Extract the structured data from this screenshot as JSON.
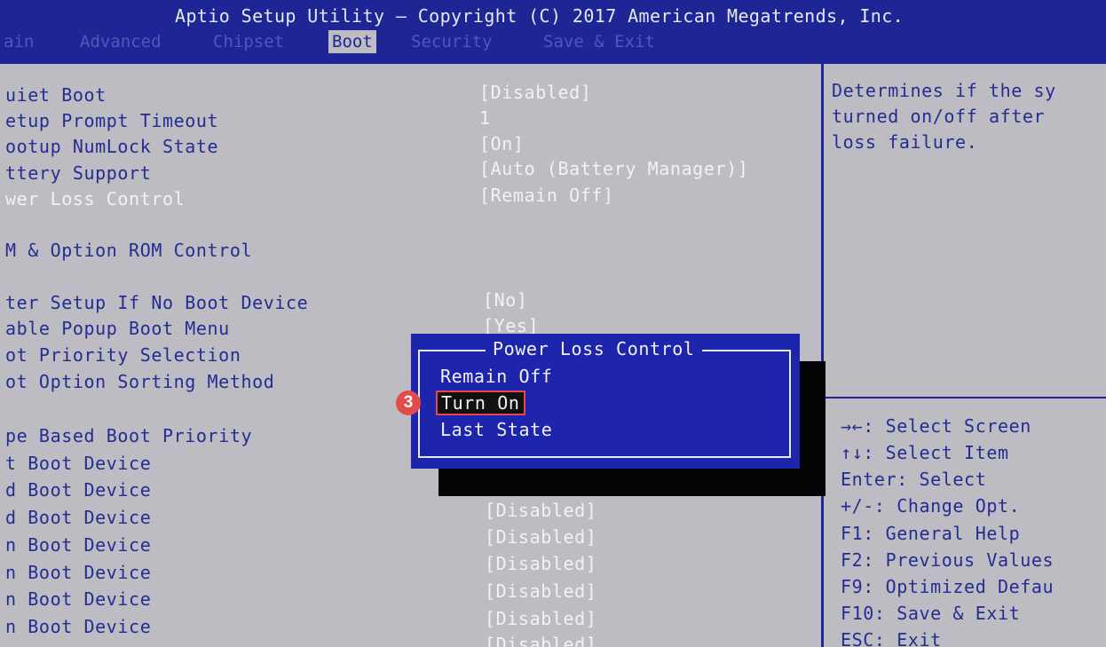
{
  "header": {
    "title": "Aptio Setup Utility – Copyright (C) 2017 American Megatrends, Inc."
  },
  "tabs": [
    {
      "label": "ain"
    },
    {
      "label": "Advanced"
    },
    {
      "label": "Chipset"
    },
    {
      "label": "Boot",
      "active": true
    },
    {
      "label": "Security"
    },
    {
      "label": "Save & Exit"
    }
  ],
  "settings": [
    {
      "label": "uiet Boot",
      "value": "[Disabled]"
    },
    {
      "label": "etup Prompt Timeout",
      "value": "1"
    },
    {
      "label": "ootup NumLock State",
      "value": "[On]"
    },
    {
      "label": "ttery Support",
      "value": "[Auto (Battery Manager)]"
    },
    {
      "label": "wer Loss Control",
      "value": "[Remain Off]"
    },
    {
      "label": "M & Option ROM Control",
      "value": ""
    },
    {
      "label": "ter Setup If No Boot Device",
      "value": "[No]"
    },
    {
      "label": "able Popup Boot Menu",
      "value": "[Yes]"
    },
    {
      "label": "ot Priority Selection",
      "value": ""
    },
    {
      "label": "ot Option Sorting Method",
      "value": ""
    },
    {
      "label": "pe Based Boot Priority",
      "value": ""
    },
    {
      "label": "t Boot Device",
      "value": ""
    },
    {
      "label": "d Boot Device",
      "value": ""
    },
    {
      "label": "d Boot Device",
      "value": "[Disabled]"
    },
    {
      "label": "n Boot Device",
      "value": "[Disabled]"
    },
    {
      "label": "n Boot Device",
      "value": "[Disabled]"
    },
    {
      "label": "n Boot Device",
      "value": "[Disabled]"
    },
    {
      "label": "n Boot Device",
      "value": "[Disabled]"
    },
    {
      "label": "",
      "value": "[Disabled]"
    }
  ],
  "help": {
    "lines": [
      "Determines if the sy",
      "turned on/off after",
      "loss failure."
    ]
  },
  "keys": [
    "→←: Select Screen",
    "↑↓: Select Item",
    "Enter: Select",
    "+/-: Change Opt.",
    "F1: General Help",
    "F2: Previous Values",
    "F9: Optimized Defau",
    "F10: Save & Exit",
    "ESC: Exit"
  ],
  "popup": {
    "title": "Power Loss Control",
    "options": [
      "Remain Off",
      "Turn On",
      "Last State"
    ],
    "selected": "Turn On"
  },
  "annotation": {
    "step": "3",
    "color": "#e34a4a"
  },
  "colors": {
    "header_bg": "#1e2594",
    "panel_bg": "#bcbcc2",
    "popup_bg": "#1e25ad",
    "highlight_border": "#e8474f"
  }
}
